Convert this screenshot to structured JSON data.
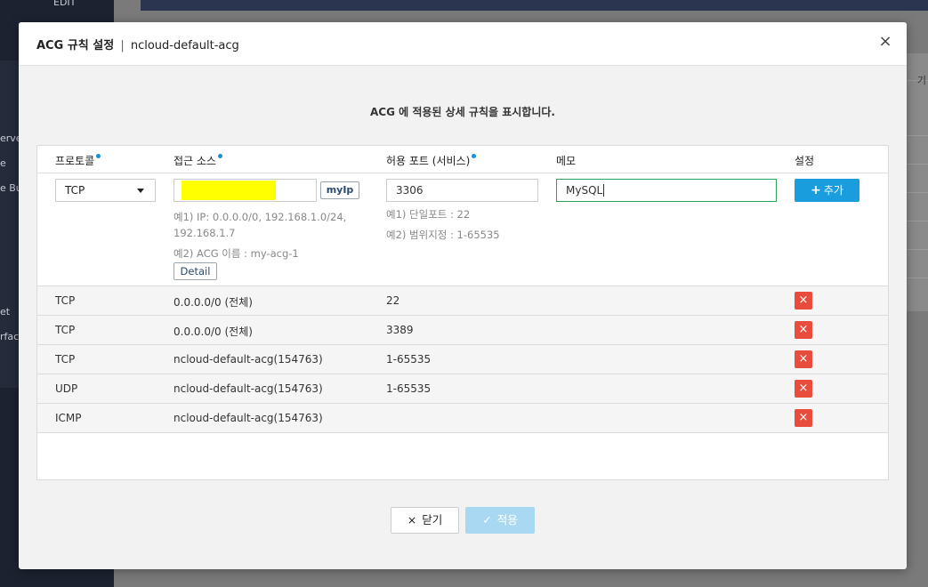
{
  "background": {
    "sidebar_fragments": [
      "EDIT",
      "erve",
      "e",
      "e Bui",
      "et",
      "rfac"
    ],
    "right_fragment": "기"
  },
  "modal": {
    "title": "ACG 규칙 설정",
    "title_separator": "|",
    "subtitle": "ncloud-default-acg",
    "close_label": "×",
    "description": "ACG 에 적용된 상세 규칙을 표시합니다."
  },
  "table": {
    "headers": {
      "protocol": "프로토콜",
      "source": "접근 소스",
      "port": "허용 포트 (서비스)",
      "memo": "메모",
      "settings": "설정"
    },
    "input_row": {
      "protocol_value": "TCP",
      "source_value": "",
      "myip_label": "myIp",
      "source_hint_1": "예1) IP: 0.0.0.0/0, 192.168.1.0/24,",
      "source_hint_1b": "192.168.1.7",
      "source_hint_2": "예2) ACG 이름 : my-acg-1",
      "detail_label": "Detail",
      "port_value": "3306",
      "port_hint_1": "예1) 단일포트 : 22",
      "port_hint_2": "예2) 범위지정 : 1-65535",
      "memo_value": "MySQL",
      "add_label": "추가",
      "add_icon": "+"
    },
    "rows": [
      {
        "protocol": "TCP",
        "source": "0.0.0.0/0 (전체)",
        "port": "22",
        "memo": ""
      },
      {
        "protocol": "TCP",
        "source": "0.0.0.0/0 (전체)",
        "port": "3389",
        "memo": ""
      },
      {
        "protocol": "TCP",
        "source": "ncloud-default-acg(154763)",
        "port": "1-65535",
        "memo": ""
      },
      {
        "protocol": "UDP",
        "source": "ncloud-default-acg(154763)",
        "port": "1-65535",
        "memo": ""
      },
      {
        "protocol": "ICMP",
        "source": "ncloud-default-acg(154763)",
        "port": "",
        "memo": ""
      }
    ],
    "delete_icon": "×"
  },
  "footer": {
    "close_label": "닫기",
    "close_icon": "×",
    "apply_label": "적용",
    "apply_icon": "✓"
  },
  "colors": {
    "accent_blue": "#1a9ddc",
    "delete_red": "#e74c3c",
    "memo_border_green": "#27a35a",
    "apply_disabled": "#a9d8f2"
  }
}
